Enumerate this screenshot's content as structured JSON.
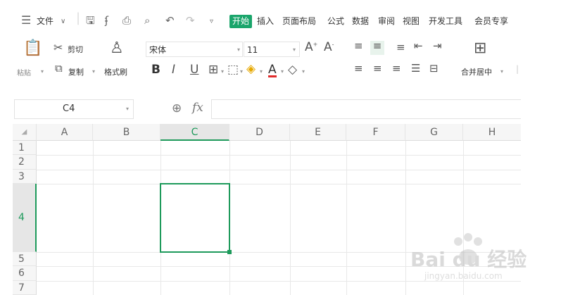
{
  "menubar": {
    "file_label": "文件",
    "tabs": [
      "开始",
      "插入",
      "页面布局",
      "公式",
      "数据",
      "审阅",
      "视图",
      "开发工具",
      "会员专享"
    ]
  },
  "ribbon": {
    "paste_label": "粘贴",
    "cut_label": "剪切",
    "copy_label": "复制",
    "format_painter_label": "格式刷",
    "font_name": "宋体",
    "font_size": "11",
    "merge_label": "合并居中"
  },
  "formula_bar": {
    "cell_ref": "C4",
    "fx": "fx"
  },
  "sheet": {
    "columns": [
      "A",
      "B",
      "C",
      "D",
      "E",
      "F",
      "G",
      "H"
    ],
    "rows": [
      "1",
      "2",
      "3",
      "4",
      "5",
      "6",
      "7"
    ],
    "selected_cell": "C4"
  },
  "watermark": {
    "text": "Bai du 经验",
    "url": "jingyan.baidu.com"
  }
}
